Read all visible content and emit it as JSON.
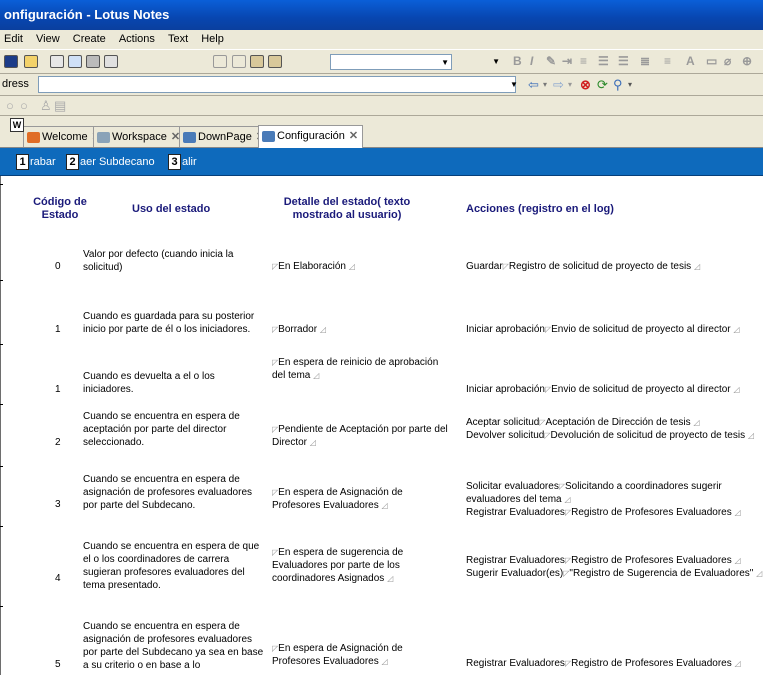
{
  "window": {
    "title": "onfiguración  - Lotus Notes"
  },
  "menu": [
    "Edit",
    "View",
    "Create",
    "Actions",
    "Text",
    "Help"
  ],
  "address": {
    "label": "dress",
    "value": ""
  },
  "tabs": [
    {
      "label": "Welcome",
      "active": false
    },
    {
      "label": "Workspace",
      "active": false
    },
    {
      "label": "DownPage",
      "active": false
    },
    {
      "label": "Configuración",
      "active": true
    }
  ],
  "actions": [
    {
      "num": "1",
      "label": "rabar"
    },
    {
      "num": "2",
      "label": "aer Subdecano"
    },
    {
      "num": "3",
      "label": "alir"
    }
  ],
  "table": {
    "headers": {
      "codigo": "Código de Estado",
      "uso": "Uso del estado",
      "detalle": "Detalle del estado( texto mostrado al usuario)",
      "acciones": "Acciones (registro en el log)"
    },
    "rows": [
      {
        "code": "0",
        "uso": "Valor por defecto (cuando inicia la solicitud)",
        "detalle": "En Elaboración",
        "acciones": [
          {
            "action": "Guardar",
            "log": "Registro de solicitud de proyecto de tesis"
          }
        ]
      },
      {
        "code": "1",
        "uso": "Cuando es guardada para su posterior inicio por parte de él o los iniciadores.",
        "detalle": "Borrador",
        "acciones": [
          {
            "action": "Iniciar aprobación",
            "log": "Envio de solicitud de proyecto al director"
          }
        ]
      },
      {
        "code": "1",
        "uso": "Cuando es devuelta a el o los iniciadores.",
        "detalle": "En espera de reinicio de aprobación del tema",
        "acciones": [
          {
            "action": "Iniciar aprobación",
            "log": "Envio de solicitud de proyecto al director"
          }
        ]
      },
      {
        "code": "2",
        "uso": "Cuando se encuentra en espera de aceptación por parte del director seleccionado.",
        "detalle": "Pendiente de Aceptación por parte del Director",
        "acciones": [
          {
            "action": "Aceptar solicitud",
            "log": "Aceptación de Dirección de tesis"
          },
          {
            "action": "Devolver solicitud",
            "log": "Devolución de solicitud de proyecto de tesis"
          }
        ]
      },
      {
        "code": "3",
        "uso": "Cuando se encuentra en espera de asignación de profesores evaluadores por parte del Subdecano.",
        "detalle": "En espera de Asignación de Profesores Evaluadores",
        "acciones": [
          {
            "action": "Solicitar evaluadores",
            "log": "Solicitando a coordinadores sugerir evaluadores del tema"
          },
          {
            "action": "Registrar Evaluadores",
            "log": "Registro de Profesores Evaluadores"
          }
        ]
      },
      {
        "code": "4",
        "uso": "Cuando se encuentra en espera de que el o los coordinadores de carrera sugieran profesores evaluadores del tema presentado.",
        "detalle": "En espera de sugerencia de Evaluadores por parte de los coordinadores Asignados",
        "acciones": [
          {
            "action": "Registrar Evaluadores",
            "log": "Registro de Profesores Evaluadores"
          },
          {
            "action": "Sugerir Evaluador(es)",
            "log": "\"Registro de Sugerencia de Evaluadores\""
          }
        ]
      },
      {
        "code": "5",
        "uso": "Cuando se encuentra en espera de asignación de profesores evaluadores por parte del Subdecano ya sea en base a su criterio o en base a lo",
        "detalle": "En espera de Asignación de Profesores Evaluadores",
        "acciones": [
          {
            "action": "Registrar Evaluadores",
            "log": "Registro de Profesores Evaluadores"
          }
        ]
      }
    ]
  }
}
